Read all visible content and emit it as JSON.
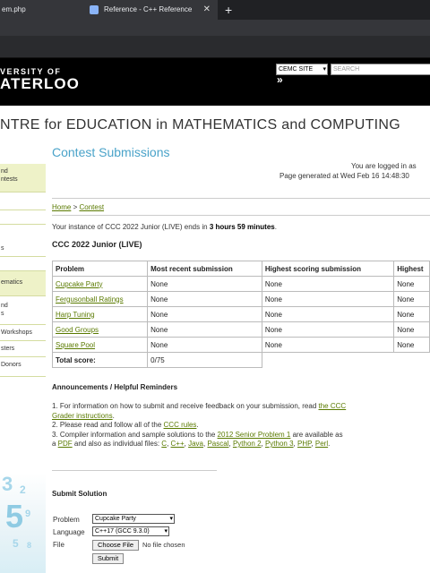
{
  "browser": {
    "tab1_title": "em.php",
    "tab2_title": "Reference - C++ Reference",
    "close_glyph": "✕",
    "new_tab_glyph": "+"
  },
  "header": {
    "logo_line1": "VERSITY OF",
    "logo_line2": "ATERLOO",
    "site_select": "CEMC SITE",
    "search_placeholder": "SEARCH",
    "go_glyph": "»"
  },
  "cemc_title": "NTRE for EDUCATION in MATHEMATICS and COMPUTING",
  "sidebar": {
    "items": [
      "nd\nntests",
      "",
      "",
      "s",
      "",
      "ematics",
      "nd\ns",
      "Workshops",
      "sters",
      "Donors"
    ]
  },
  "main": {
    "heading": "Contest Submissions",
    "logged_in": "You are logged in as",
    "generated": "Page generated at Wed Feb 16 14:48:30",
    "breadcrumb_home": "Home",
    "breadcrumb_sep": " > ",
    "breadcrumb_contest": "Contest",
    "instance_prefix": "Your instance of CCC 2022 Junior (LIVE) ends in ",
    "instance_time": "3 hours 59 minutes",
    "instance_suffix": ".",
    "contest_name": "CCC 2022 Junior (LIVE)"
  },
  "table": {
    "headers": [
      "Problem",
      "Most recent submission",
      "Highest scoring submission",
      "Highest"
    ],
    "rows": [
      [
        "Cupcake Party",
        "None",
        "None",
        "None"
      ],
      [
        "Fergusonball Ratings",
        "None",
        "None",
        "None"
      ],
      [
        "Harp Tuning",
        "None",
        "None",
        "None"
      ],
      [
        "Good Groups",
        "None",
        "None",
        "None"
      ],
      [
        "Square Pool",
        "None",
        "None",
        "None"
      ]
    ],
    "total_label": "Total score:",
    "total_value": "0/75"
  },
  "announcements": {
    "title": "Announcements / Helpful Reminders",
    "l1a": "1. For information on how to submit and receive feedback on your submission, read ",
    "l1link": "the CCC Grader instructions",
    "l1b": ".",
    "l2a": "2. Please read and follow all of the ",
    "l2link": "CCC rules",
    "l2b": ".",
    "l3a": "3. Compiler information and sample solutions to the ",
    "l3link": "2012 Senior Problem 1",
    "l3b": " are available as a ",
    "pdf": "PDF",
    "l3c": " and also as individual files: ",
    "files": [
      "C",
      "C++",
      "Java",
      "Pascal",
      "Python 2",
      "Python 3",
      "PHP",
      "Perl"
    ],
    "end": "."
  },
  "submit": {
    "title": "Submit Solution",
    "problem_label": "Problem",
    "problem_value": "Cupcake Party",
    "language_label": "Language",
    "language_value": "C++17 (GCC 9.3.0)",
    "file_label": "File",
    "choose_file": "Choose File",
    "no_file": "No file chosen",
    "submit_label": "Submit"
  },
  "colors": {
    "accent_blue": "#4aa3c9",
    "link_green": "#5a7a00",
    "sidebar_highlight": "#eef2c8"
  }
}
